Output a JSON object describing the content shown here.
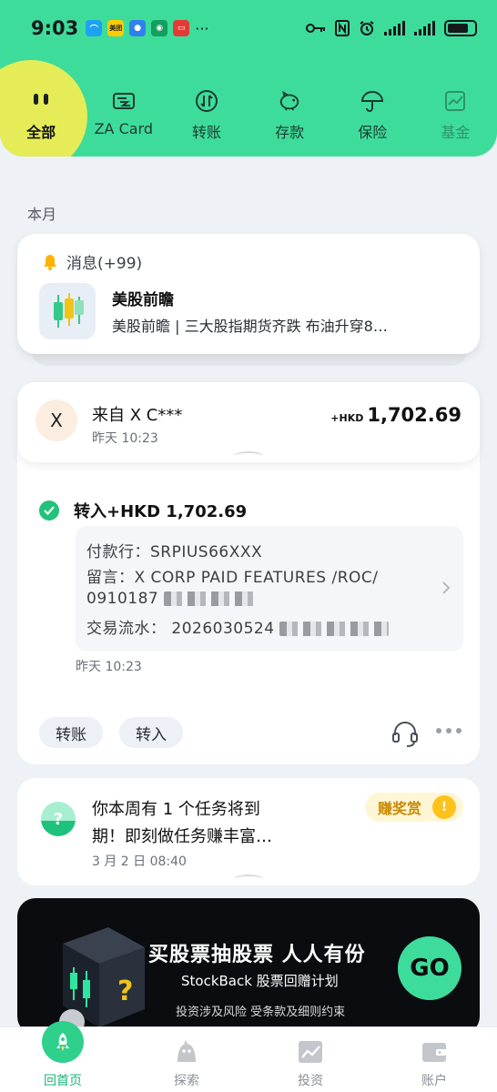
{
  "status_bar": {
    "time": "9:03",
    "apps": [
      {
        "icon": "chat-app-icon",
        "color": "#1da1f2"
      },
      {
        "icon": "meituan-app-icon",
        "color": "#ffcc00",
        "text": "美团"
      },
      {
        "icon": "message-app-icon",
        "color": "#2f80ed"
      },
      {
        "icon": "green-app-icon",
        "color": "#12a05c"
      },
      {
        "icon": "red-app-icon",
        "color": "#e53935"
      }
    ],
    "more": "···"
  },
  "top_nav": {
    "items": [
      {
        "label": "全部",
        "icon": "face-icon",
        "active": true
      },
      {
        "label": "ZA Card",
        "icon": "card-icon"
      },
      {
        "label": "转账",
        "icon": "transfer-icon"
      },
      {
        "label": "存款",
        "icon": "piggy-bank-icon"
      },
      {
        "label": "保险",
        "icon": "umbrella-icon"
      },
      {
        "label": "基金",
        "icon": "fund-chart-icon"
      }
    ]
  },
  "section_label": "本月",
  "message_card": {
    "header": "消息(+99)",
    "title": "美股前瞻",
    "body": "美股前瞻 | 三大股指期货齐跌 布油升穿8…"
  },
  "transaction": {
    "avatar_letter": "X",
    "from": "来自 X C***",
    "time": "昨天 10:23",
    "currency": "+HKD",
    "amount": "1,702.69",
    "status": "转入+HKD 1,702.69",
    "details": {
      "payer": "付款行：SRPIUS66XXX",
      "memo": "留言：X CORP PAID FEATURES /ROC/",
      "memo_cont": "0910187",
      "ref": "交易流水：  2026030524"
    },
    "detail_time": "昨天 10:23",
    "tags": [
      "转账",
      "转入"
    ]
  },
  "task_card": {
    "line1": "你本周有 1 个任务将到",
    "line2": "期！即刻做任务赚丰富…",
    "date": "3 月 2 日 08:40",
    "reward": "赚奖赏"
  },
  "banner": {
    "title": "买股票抽股票 人人有份",
    "subtitle": "StockBack 股票回赠计划",
    "note": "投资涉及风险 受条款及细则约束",
    "cta": "GO"
  },
  "tab_bar": {
    "items": [
      {
        "label": "回首页",
        "icon": "rocket-icon",
        "active": true
      },
      {
        "label": "探索",
        "icon": "explore-icon"
      },
      {
        "label": "投资",
        "icon": "invest-chart-icon"
      },
      {
        "label": "账户",
        "icon": "wallet-icon"
      }
    ]
  },
  "colors": {
    "brand": "#3ddc9b",
    "accent_yellow": "#e5ec57",
    "success": "#22c27a"
  }
}
